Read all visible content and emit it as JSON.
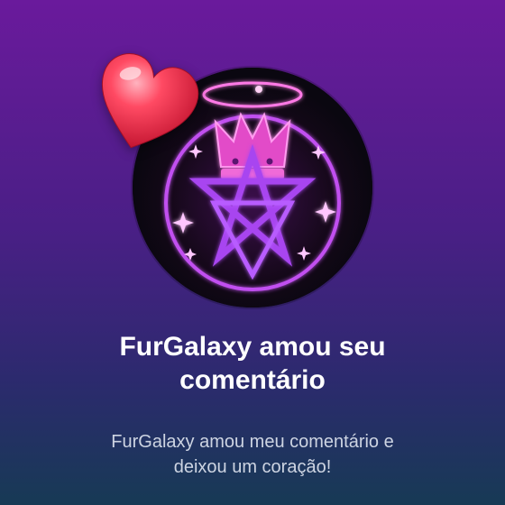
{
  "notification": {
    "title_line1": "FurGalaxy amou seu",
    "title_line2": "comentário",
    "body_line1": "FurGalaxy amou meu comentário e",
    "body_line2": "deixou um coração!"
  },
  "icons": {
    "avatar": "crown-pentagram-emblem",
    "reaction": "heart-icon"
  },
  "colors": {
    "background_top": "#6a1a9c",
    "background_bottom": "#173a55",
    "accent_neon": "#ff4fd8",
    "heart": "#f0324c"
  }
}
